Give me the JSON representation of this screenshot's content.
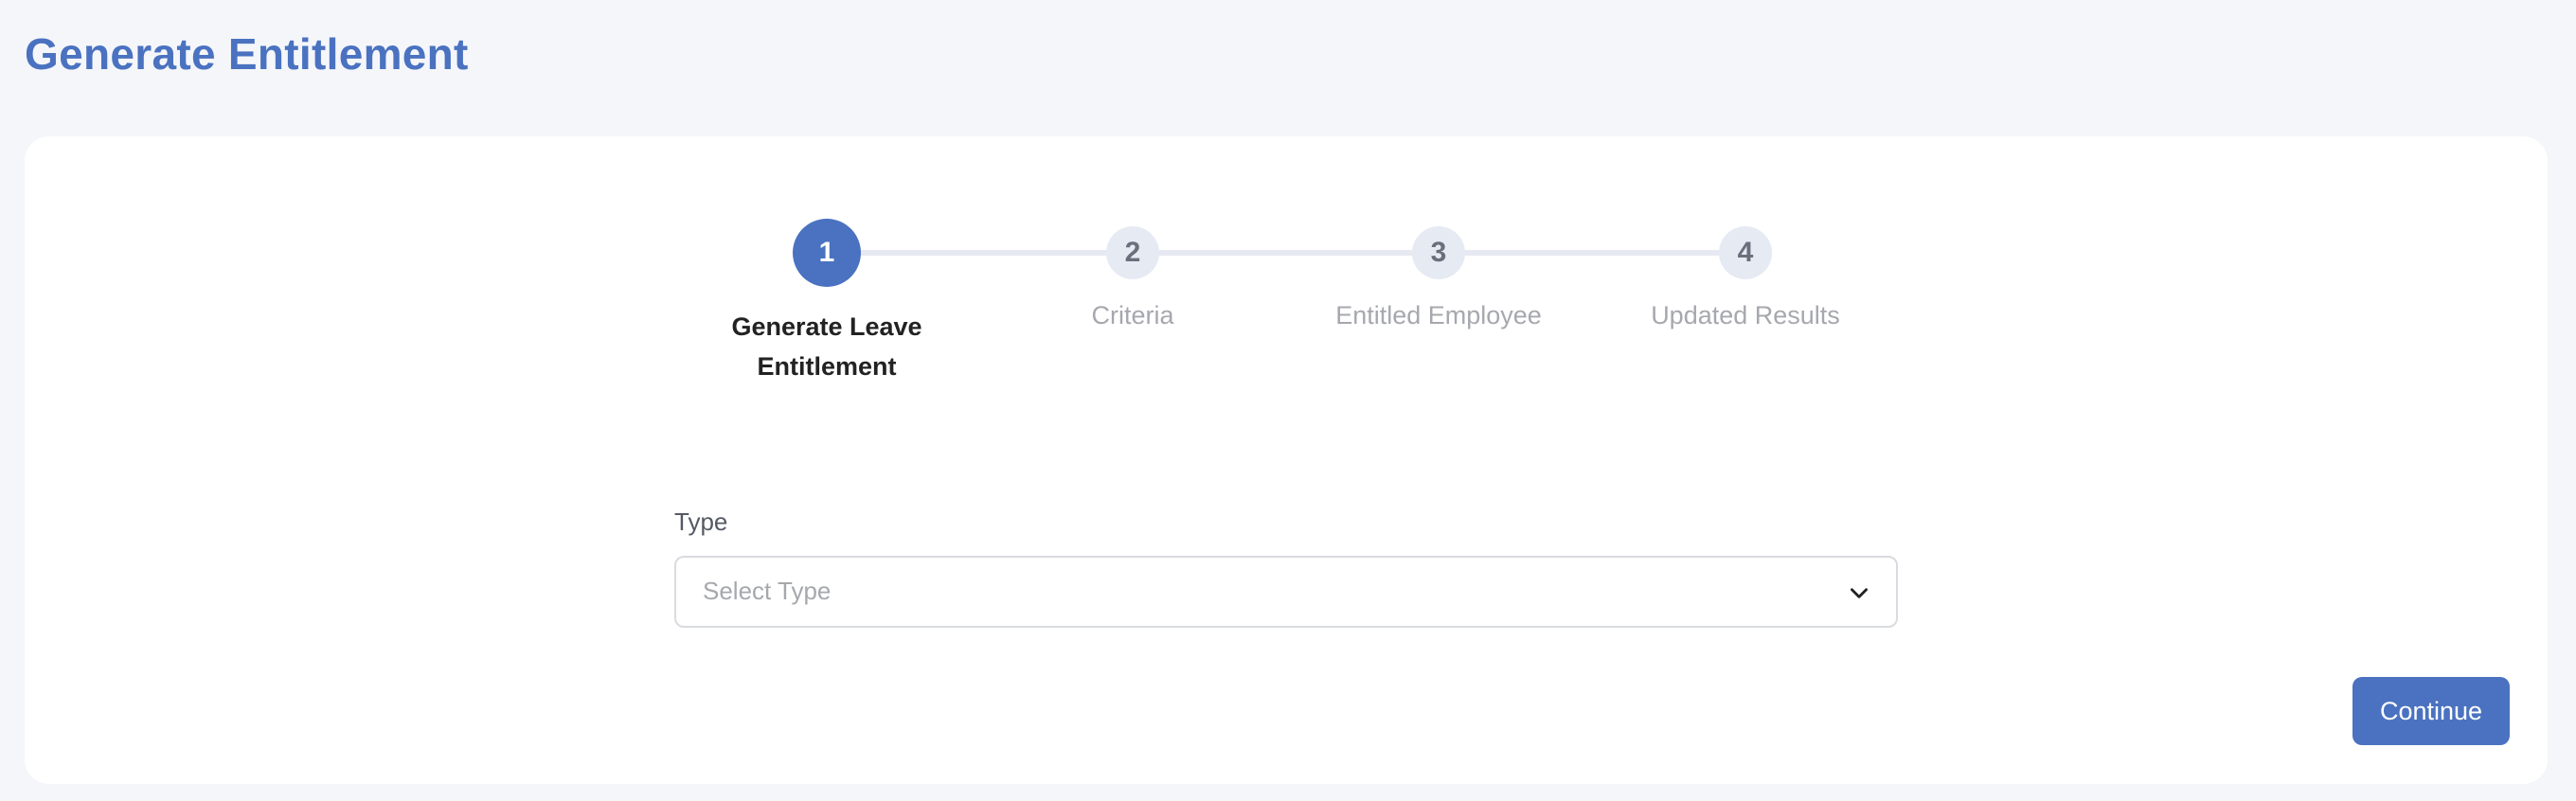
{
  "page": {
    "title": "Generate Entitlement"
  },
  "stepper": {
    "steps": [
      {
        "number": "1",
        "label": "Generate Leave Entitlement",
        "active": true
      },
      {
        "number": "2",
        "label": "Criteria",
        "active": false
      },
      {
        "number": "3",
        "label": "Entitled Employee",
        "active": false
      },
      {
        "number": "4",
        "label": "Updated Results",
        "active": false
      }
    ]
  },
  "form": {
    "type_label": "Type",
    "type_select": {
      "placeholder": "Select Type",
      "value": ""
    }
  },
  "actions": {
    "continue_label": "Continue"
  },
  "colors": {
    "accent": "#4a72c0",
    "background": "#f5f6fa",
    "inactive_step": "#e6eaf3"
  }
}
